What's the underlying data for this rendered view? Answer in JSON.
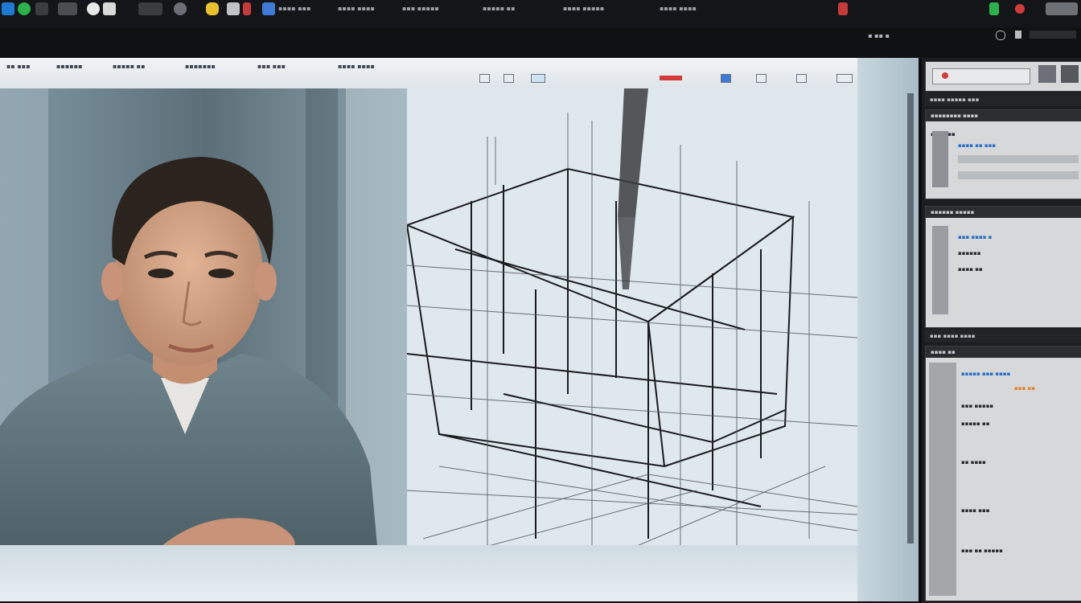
{
  "taskbar": {
    "items": [
      "▪▪▪▪ ▪▪▪",
      "▪▪▪▪ ▪▪▪▪",
      "▪▪▪ ▪▪▪▪▪",
      "▪▪▪▪▪ ▪▪",
      "▪▪▪▪ ▪▪▪▪▪",
      "▪▪▪▪ ▪▪▪▪"
    ],
    "status_text": "▪ ▪▪ ▪"
  },
  "app_toolbar": {
    "labels": [
      "▪▪ ▪▪▪",
      "▪▪▪▪▪▪",
      "▪▪▪▪▪ ▪▪",
      "▪▪▪▪▪▪▪",
      "▪▪▪ ▪▪▪",
      "▪▪▪▪ ▪▪▪▪"
    ]
  },
  "side_panels": {
    "top_header": "▪▪▪▪ ▪▪▪▪▪ ▪▪▪",
    "properties_header": "▪▪▪▪▪▪▪▪ ▪▪▪▪",
    "layers_header": "▪▪▪▪▪▪ ▪▪▪▪▪",
    "history_header": "▪▪▪ ▪▪▪▪ ▪▪▪▪"
  },
  "colors": {
    "accent_blue": "#2a6ec8",
    "accent_red": "#d33a3a",
    "accent_orange": "#e0822c",
    "canvas_bg": "#c9d8df"
  }
}
